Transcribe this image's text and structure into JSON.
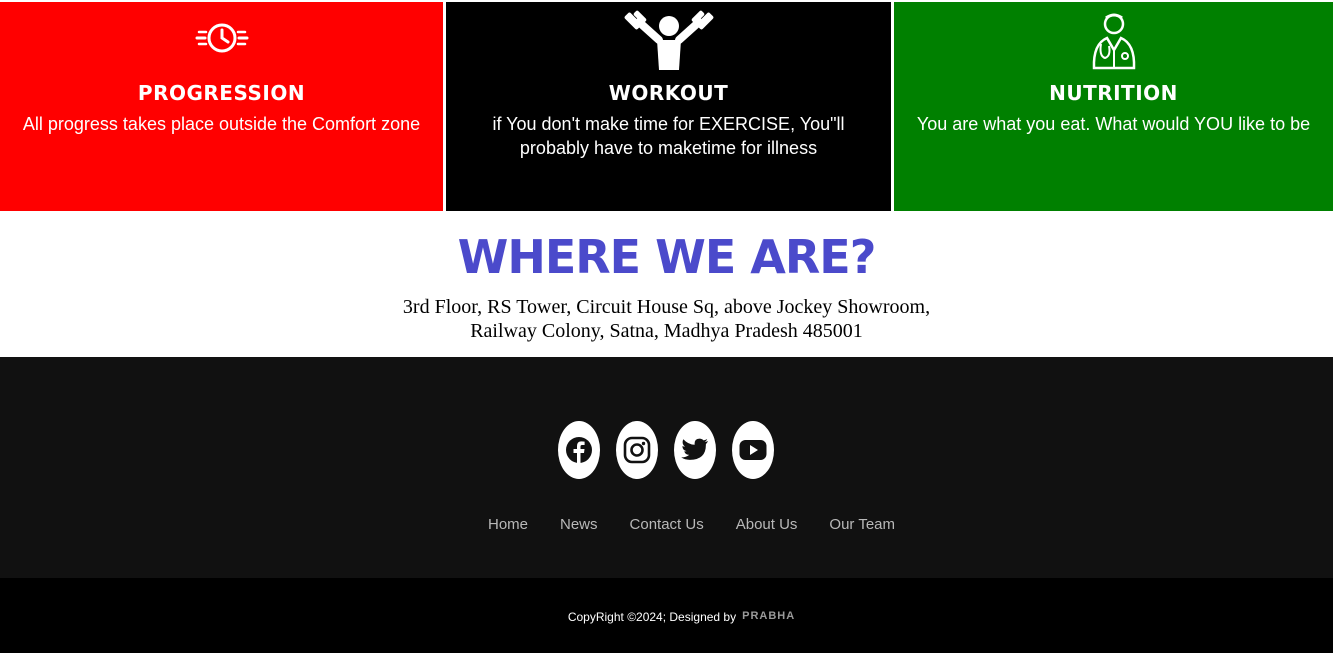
{
  "features": [
    {
      "title": "PROGRESSION",
      "text": "All progress takes place outside the Comfort zone",
      "icon": "clock-icon",
      "color": "#ff0000"
    },
    {
      "title": "WORKOUT",
      "text": "if You don't make time for EXERCISE, You\"ll probably have to maketime for illness",
      "icon": "weightlifter-icon",
      "color": "#000000"
    },
    {
      "title": "NUTRITION",
      "text": "You are what you eat. What would YOU like to be",
      "icon": "doctor-icon",
      "color": "#008000"
    }
  ],
  "location": {
    "title": "WHERE WE ARE?",
    "address_line1": "3rd Floor, RS Tower, Circuit House Sq, above Jockey Showroom,",
    "address_line2": "Railway Colony, Satna, Madhya Pradesh 485001",
    "title_color": "#4b4acb"
  },
  "socials": [
    {
      "icon": "facebook-icon"
    },
    {
      "icon": "instagram-icon"
    },
    {
      "icon": "twitter-icon"
    },
    {
      "icon": "youtube-icon"
    }
  ],
  "nav": [
    "Home",
    "News",
    "Contact Us",
    "About Us",
    "Our Team"
  ],
  "copyright": {
    "text": "CopyRight ©2024; Designed by",
    "brand": "PRABHA"
  }
}
